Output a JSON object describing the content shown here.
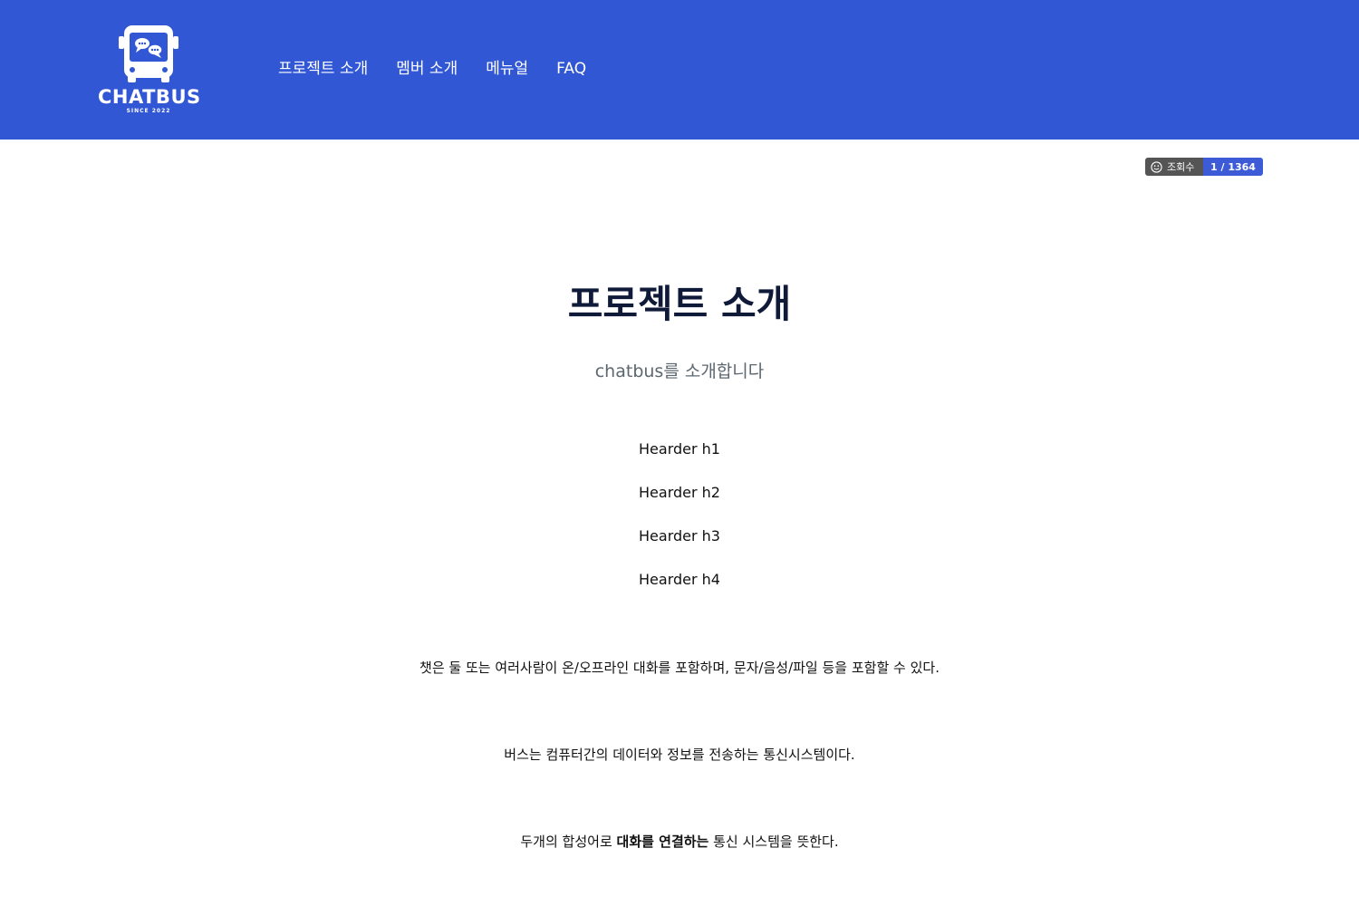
{
  "brand": {
    "name": "CHATBUS",
    "since": "SINCE 2022"
  },
  "nav": {
    "items": [
      {
        "label": "프로젝트 소개"
      },
      {
        "label": "멤버 소개"
      },
      {
        "label": "메뉴얼"
      },
      {
        "label": "FAQ"
      }
    ]
  },
  "hit_counter": {
    "label": "조회수",
    "value": "1 / 1364"
  },
  "main": {
    "title": "프로젝트 소개",
    "subtitle": "chatbus를 소개합니다",
    "headers": [
      "Hearder h1",
      "Hearder h2",
      "Hearder h3",
      "Hearder h4"
    ],
    "paragraph1": "챗은 둘 또는 여러사람이 온/오프라인 대화를 포함하며, 문자/음성/파일 등을 포함할 수 있다.",
    "paragraph2": "버스는 컴퓨터간의 데이터와 정보를 전송하는 통신시스템이다.",
    "paragraph3": {
      "before": "두개의 합성어로 ",
      "bold": "대화를 연결하는",
      "after": " 통신 시스템을 뜻한다."
    }
  },
  "colors": {
    "header_bg": "#3157d5",
    "title": "#0f1938",
    "subtitle": "#5c6770",
    "counter_left": "#555555",
    "counter_right": "#3d5bd6"
  }
}
